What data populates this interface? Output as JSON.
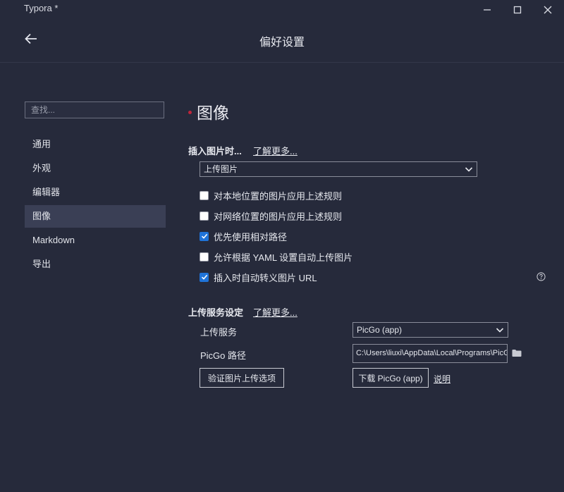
{
  "window": {
    "app_title": "Typora *"
  },
  "header": {
    "title": "偏好设置"
  },
  "sidebar": {
    "search_placeholder": "查找...",
    "items": [
      {
        "label": "通用"
      },
      {
        "label": "外观"
      },
      {
        "label": "编辑器"
      },
      {
        "label": "图像",
        "active": true
      },
      {
        "label": "Markdown"
      },
      {
        "label": "导出"
      }
    ]
  },
  "image_section": {
    "title": "图像",
    "insert_label": "插入图片时...",
    "insert_learn_more": "了解更多...",
    "insert_action_selected": "上传图片",
    "options": [
      {
        "label": "对本地位置的图片应用上述规则",
        "checked": false
      },
      {
        "label": "对网络位置的图片应用上述规则",
        "checked": false
      },
      {
        "label": "优先使用相对路径",
        "checked": true
      },
      {
        "label": "允许根据 YAML 设置自动上传图片",
        "checked": false
      },
      {
        "label": "插入时自动转义图片 URL",
        "checked": true
      }
    ],
    "upload_label": "上传服务设定",
    "upload_learn_more": "了解更多...",
    "upload_service_label": "上传服务",
    "upload_service_selected": "PicGo (app)",
    "picgo_path_label": "PicGo 路径",
    "picgo_path_value": "C:\\Users\\liuxi\\AppData\\Local\\Programs\\PicGo",
    "verify_button": "验证图片上传选项",
    "download_button": "下载 PicGo (app)",
    "doc_link": "说明"
  },
  "colors": {
    "background": "#262a3b",
    "active_item": "#3a3f55",
    "accent_dot": "#c0243a",
    "checkbox_checked": "#1f73d8"
  }
}
